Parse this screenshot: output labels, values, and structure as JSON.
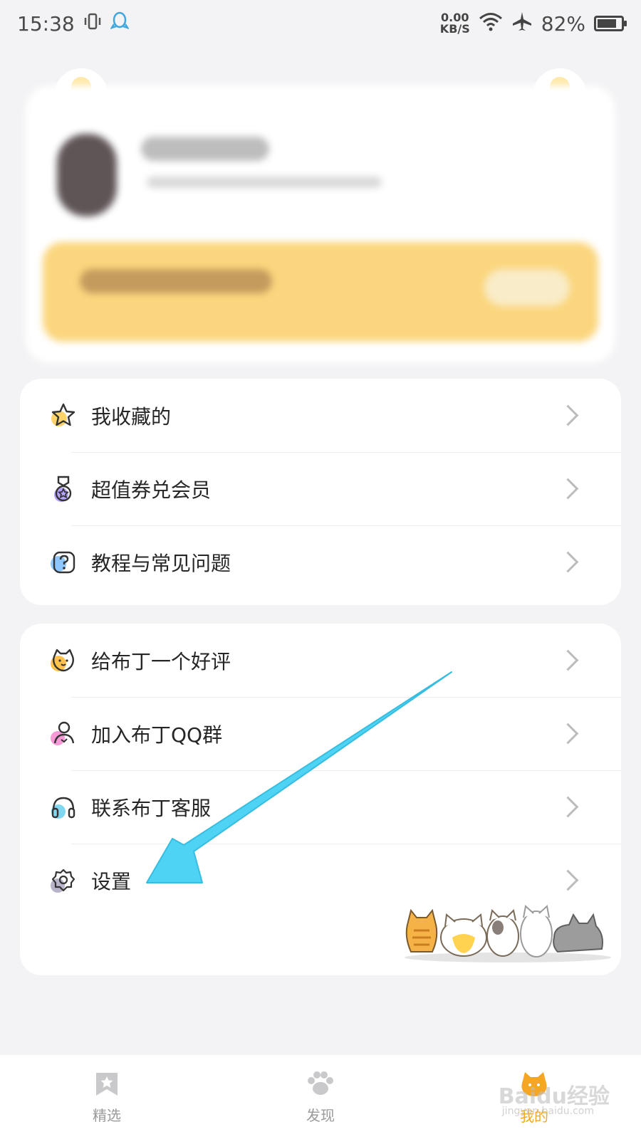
{
  "status_bar": {
    "time": "15:38",
    "net_speed_value": "0.00",
    "net_speed_unit": "KB/S",
    "battery_percent": "82%",
    "battery_level": 0.82
  },
  "menu_group_1": {
    "items": [
      {
        "label": "我收藏的",
        "icon": "star-icon"
      },
      {
        "label": "超值券兑会员",
        "icon": "medal-icon"
      },
      {
        "label": "教程与常见问题",
        "icon": "help-icon"
      }
    ]
  },
  "menu_group_2": {
    "items": [
      {
        "label": "给布丁一个好评",
        "icon": "cat-face-icon"
      },
      {
        "label": "加入布丁QQ群",
        "icon": "user-group-icon"
      },
      {
        "label": "联系布丁客服",
        "icon": "headset-icon"
      },
      {
        "label": "设置",
        "icon": "gear-icon"
      }
    ]
  },
  "bottom_nav": {
    "items": [
      {
        "label": "精选",
        "icon": "bookmark-star-icon",
        "active": false
      },
      {
        "label": "发现",
        "icon": "paw-icon",
        "active": false
      },
      {
        "label": "我的",
        "icon": "cat-profile-icon",
        "active": true
      }
    ]
  },
  "watermark": {
    "text": "Baidu经验",
    "sub": "jingyan.baidu.com"
  },
  "colors": {
    "accent": "#f5a623",
    "arrow": "#4fd3f4",
    "vip_banner": "#fbd67e"
  }
}
